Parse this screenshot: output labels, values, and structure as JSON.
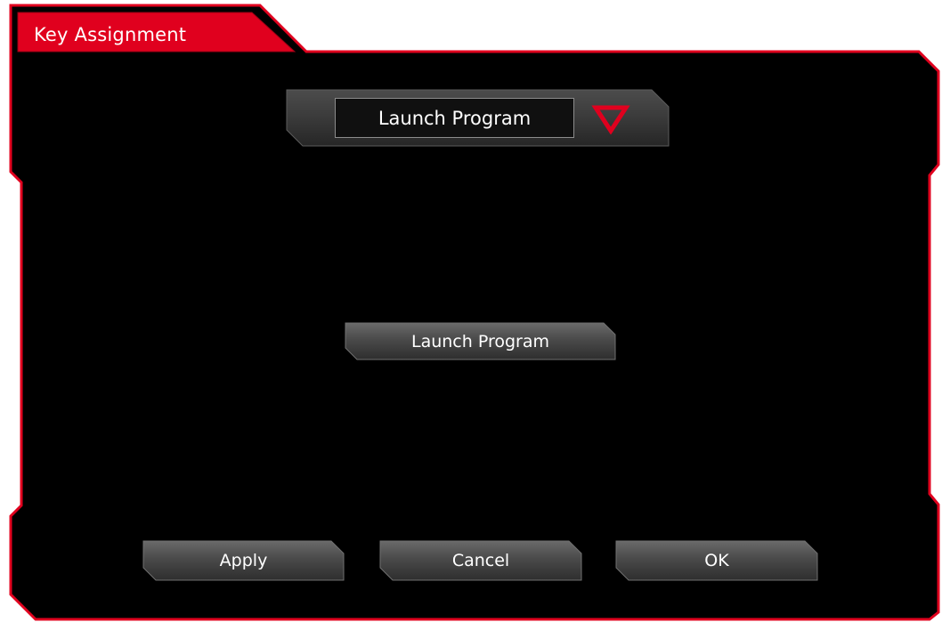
{
  "dialog": {
    "title": "Key Assignment"
  },
  "mode_select": {
    "selected": "Launch Program"
  },
  "launch_button": {
    "label": "Launch Program"
  },
  "footer": {
    "apply_label": "Apply",
    "cancel_label": "Cancel",
    "ok_label": "OK"
  },
  "colors": {
    "accent_red": "#e0001e",
    "background": "#000000",
    "button_gray": "#4a4a4a"
  }
}
